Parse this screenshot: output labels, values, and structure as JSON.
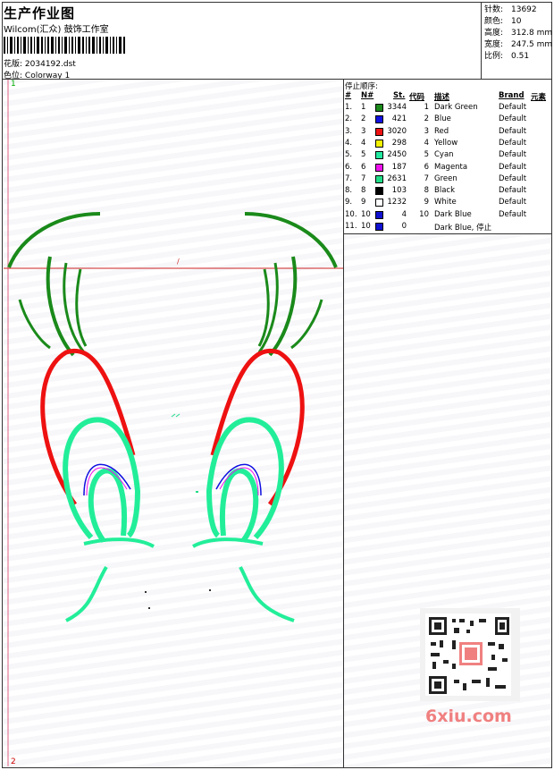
{
  "header": {
    "title": "生产作业图",
    "company": "Wilcom(汇众) 鼓饰工作室",
    "design_label": "花版:",
    "design_value": "2034192.dst",
    "colorway_label": "色位:",
    "colorway_value": "Colorway 1"
  },
  "stats": {
    "stitches_label": "针数:",
    "stitches_value": "13692",
    "colors_label": "颜色:",
    "colors_value": "10",
    "height_label": "高度:",
    "height_value": "312.8 mm",
    "width_label": "宽度:",
    "width_value": "247.5 mm",
    "scale_label": "比例:",
    "scale_value": "0.51"
  },
  "stop_sequence": {
    "caption": "停止顺序:",
    "headers": {
      "num": "#",
      "n": "N#",
      "st": "St.",
      "code": "代码",
      "desc": "描述",
      "brand": "Brand",
      "elem": "元素"
    },
    "rows": [
      {
        "num": "1.",
        "n": "1",
        "st": "3344",
        "code": "1",
        "desc": "Dark Green",
        "brand": "Default",
        "color": "#1a8a1a"
      },
      {
        "num": "2.",
        "n": "2",
        "st": "421",
        "code": "2",
        "desc": "Blue",
        "brand": "Default",
        "color": "#1010e0"
      },
      {
        "num": "3.",
        "n": "3",
        "st": "3020",
        "code": "3",
        "desc": "Red",
        "brand": "Default",
        "color": "#ee1111"
      },
      {
        "num": "4.",
        "n": "4",
        "st": "298",
        "code": "4",
        "desc": "Yellow",
        "brand": "Default",
        "color": "#f2f200"
      },
      {
        "num": "5.",
        "n": "5",
        "st": "2450",
        "code": "5",
        "desc": "Cyan",
        "brand": "Default",
        "color": "#22e8a0"
      },
      {
        "num": "6.",
        "n": "6",
        "st": "187",
        "code": "6",
        "desc": "Magenta",
        "brand": "Default",
        "color": "#ee11ee"
      },
      {
        "num": "7.",
        "n": "7",
        "st": "2631",
        "code": "7",
        "desc": "Green",
        "brand": "Default",
        "color": "#22dd88"
      },
      {
        "num": "8.",
        "n": "8",
        "st": "103",
        "code": "8",
        "desc": "Black",
        "brand": "Default",
        "color": "#000000"
      },
      {
        "num": "9.",
        "n": "9",
        "st": "1232",
        "code": "9",
        "desc": "White",
        "brand": "Default",
        "color": "#ffffff"
      },
      {
        "num": "10.",
        "n": "10",
        "st": "4",
        "code": "10",
        "desc": "Dark Blue",
        "brand": "Default",
        "color": "#1010d0"
      },
      {
        "num": "11.",
        "n": "10",
        "st": "0",
        "code": "",
        "desc": "Dark Blue, 停止",
        "brand": "",
        "color": "#1010d0"
      }
    ]
  },
  "canvas": {
    "marker_top": "1",
    "marker_bottom": "2"
  },
  "watermark": {
    "text": "6xiu.com"
  }
}
